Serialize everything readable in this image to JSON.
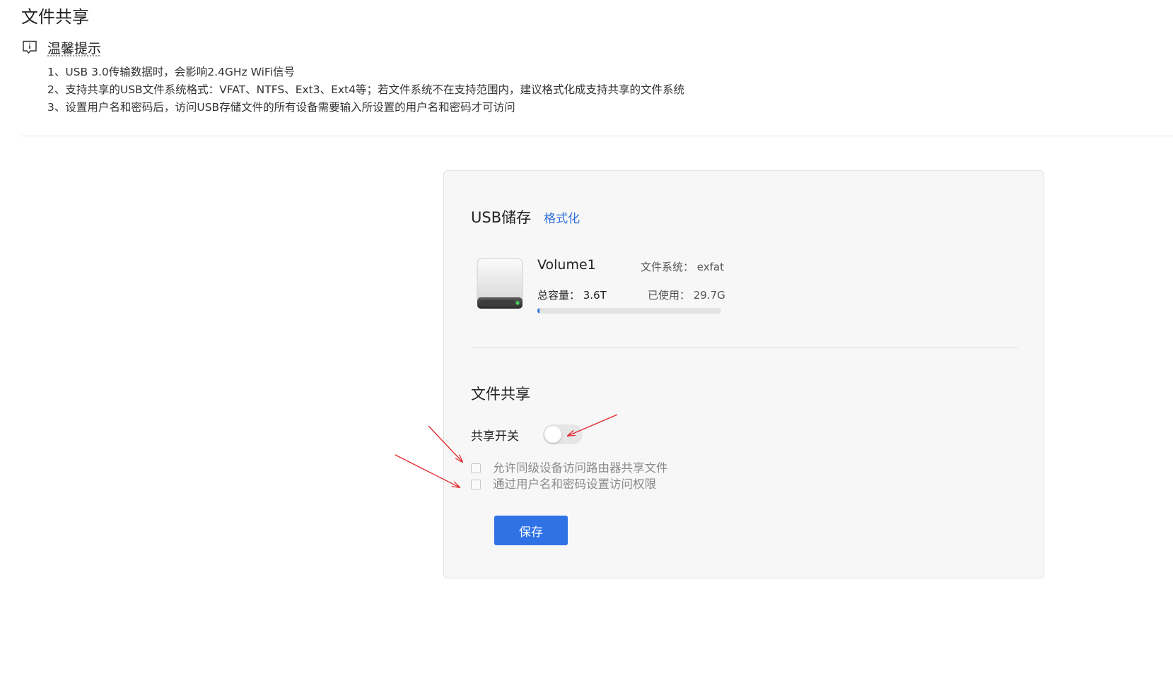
{
  "page": {
    "title": "文件共享"
  },
  "tips": {
    "icon": "info-message-icon",
    "title": "温馨提示",
    "items": [
      "1、USB 3.0传输数据时，会影响2.4GHz WiFi信号",
      "2、支持共享的USB文件系统格式：VFAT、NTFS、Ext3、Ext4等；若文件系统不在支持范围内，建议格式化成支持共享的文件系统",
      "3、设置用户名和密码后，访问USB存储文件的所有设备需要输入所设置的用户名和密码才可访问"
    ]
  },
  "usb": {
    "title": "USB储存",
    "format_link": "格式化",
    "volume": {
      "icon": "hard-drive-icon",
      "name": "Volume1",
      "filesystem_text": "文件系统： exfat",
      "capacity_text": "总容量： 3.6T",
      "used_text": "已使用： 29.7G",
      "usage_fraction": 0.008
    }
  },
  "share": {
    "title": "文件共享",
    "switch_label": "共享开关",
    "switch_on": false,
    "options": [
      {
        "label": "允许同级设备访问路由器共享文件",
        "checked": false
      },
      {
        "label": "通过用户名和密码设置访问权限",
        "checked": false
      }
    ],
    "save_label": "保存"
  },
  "colors": {
    "accent": "#2f72e6",
    "link": "#2f6fde",
    "annotation_arrow": "#e0262b"
  }
}
